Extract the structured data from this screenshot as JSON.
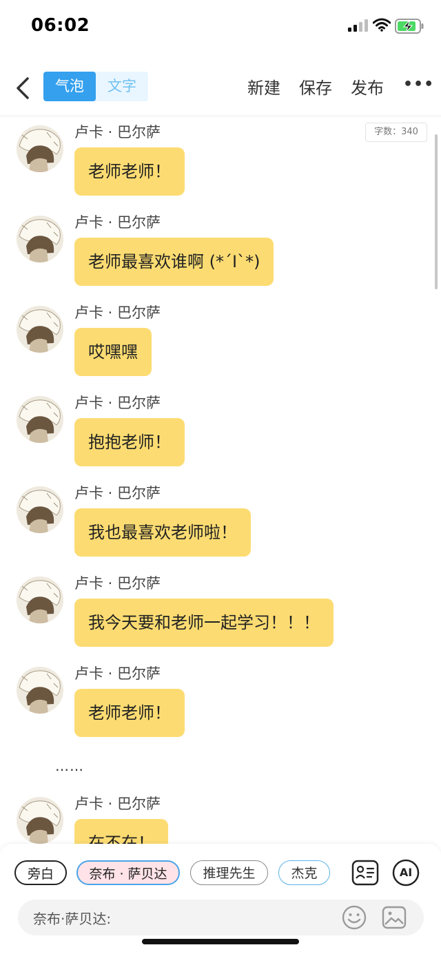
{
  "status_bar": {
    "time": "06:02"
  },
  "nav": {
    "mode_bubble": "气泡",
    "mode_text": "文字",
    "new_label": "新建",
    "save_label": "保存",
    "publish_label": "发布",
    "more_label": "•••"
  },
  "chat": {
    "word_count": "字数：340",
    "messages": [
      {
        "sender": "卢卡 · 巴尔萨",
        "text": "老师老师！"
      },
      {
        "sender": "卢卡 · 巴尔萨",
        "text": "老师最喜欢谁啊 (*´I`*)"
      },
      {
        "sender": "卢卡 · 巴尔萨",
        "text": "哎嘿嘿"
      },
      {
        "sender": "卢卡 · 巴尔萨",
        "text": "抱抱老师！"
      },
      {
        "sender": "卢卡 · 巴尔萨",
        "text": "我也最喜欢老师啦！"
      },
      {
        "sender": "卢卡 · 巴尔萨",
        "text": "我今天要和老师一起学习！！！"
      },
      {
        "sender": "卢卡 · 巴尔萨",
        "text": "老师老师！"
      }
    ],
    "ellipsis": "……",
    "last_message": {
      "sender": "卢卡 · 巴尔萨",
      "text": "在不在！"
    }
  },
  "bottom": {
    "roles": [
      "旁白",
      "奈布 · 萨贝达",
      "推理先生",
      "杰克"
    ],
    "ai_label": "AI",
    "input_value": "奈布·萨贝达:"
  },
  "colors": {
    "bubble": "#fcdc72",
    "accent": "#34a0ee",
    "selected_role_bg": "#ffe3e8"
  }
}
